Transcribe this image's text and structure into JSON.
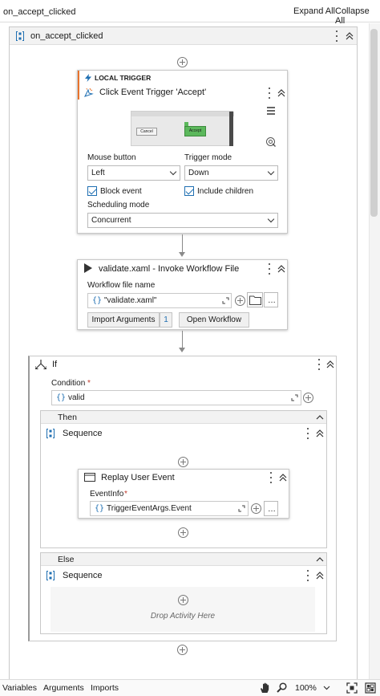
{
  "topbar": {
    "title": "on_accept_clicked",
    "expand_all": "Expand All",
    "collapse_all": "Collapse All"
  },
  "root_sequence": {
    "title": "on_accept_clicked"
  },
  "trigger": {
    "category": "LOCAL TRIGGER",
    "title": "Click Event Trigger 'Accept'",
    "preview": {
      "cancel": "Cancel",
      "accept": "Accept"
    },
    "mouse_button_label": "Mouse button",
    "mouse_button_value": "Left",
    "trigger_mode_label": "Trigger mode",
    "trigger_mode_value": "Down",
    "block_event_label": "Block event",
    "block_event_checked": true,
    "include_children_label": "Include children",
    "include_children_checked": true,
    "scheduling_label": "Scheduling mode",
    "scheduling_value": "Concurrent"
  },
  "invoke": {
    "title": "validate.xaml - Invoke Workflow File",
    "file_label": "Workflow file name",
    "file_value": "\"validate.xaml\"",
    "import_label": "Import Arguments",
    "import_count": "1",
    "open_label": "Open Workflow"
  },
  "if_block": {
    "title": "If",
    "condition_label": "Condition",
    "required_mark": "*",
    "condition_value": "valid",
    "then_label": "Then",
    "else_label": "Else",
    "then_sequence_title": "Sequence",
    "else_sequence_title": "Sequence",
    "drop_hint": "Drop Activity Here"
  },
  "replay": {
    "title": "Replay User Event",
    "eventinfo_label": "EventInfo",
    "eventinfo_value": "TriggerEventArgs.Event"
  },
  "bottombar": {
    "variables": "Variables",
    "arguments": "Arguments",
    "imports": "Imports",
    "zoom": "100%"
  },
  "colors": {
    "accent": "#1f6fb2",
    "trigger_accent": "#e8732c",
    "preview_accept": "#5cb85c"
  }
}
